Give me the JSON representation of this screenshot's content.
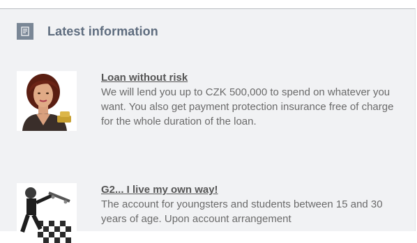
{
  "section": {
    "title": "Latest information",
    "icon": "document-list-icon"
  },
  "news": [
    {
      "title": "Loan without risk",
      "description": "We will lend you up to CZK 500,000 to spend on whatever you want. You also get payment protection insurance free of charge for the whole duration of the loan.",
      "image": "woman-portrait-photo"
    },
    {
      "title": "G2... I live my own way!",
      "description": "The account for youngsters and students between 15 and 30 years of age. Upon account arrangement",
      "image": "skateboarder-photo"
    }
  ],
  "colors": {
    "panel_background": "#f1f2f4",
    "header_text": "#5e6c7e",
    "link_text": "#555555",
    "body_text": "#6a6a6a"
  }
}
